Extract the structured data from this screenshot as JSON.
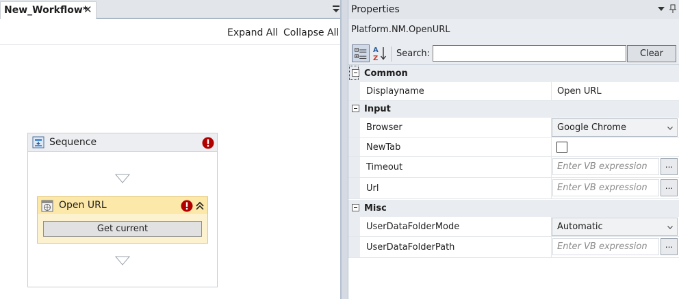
{
  "designer": {
    "tab_title": "New_Workflow*",
    "tab_close_icon": "close-icon",
    "expand_all": "Expand All",
    "collapse_all": "Collapse All",
    "sequence": {
      "title": "Sequence",
      "icon": "sequence-icon",
      "has_error": true,
      "activity": {
        "title": "Open URL",
        "icon": "browser-icon",
        "has_error": true,
        "button_label": "Get current"
      }
    }
  },
  "properties": {
    "title": "Properties",
    "class_name": "Platform.NM.OpenURL",
    "search_label": "Search:",
    "search_value": "",
    "clear_label": "Clear",
    "categories": [
      {
        "label": "Common",
        "rows": [
          {
            "name": "Displayname",
            "value": "Open URL"
          }
        ]
      },
      {
        "label": "Input",
        "rows": [
          {
            "name": "Browser",
            "value": "Google Chrome"
          },
          {
            "name": "NewTab",
            "value": ""
          },
          {
            "name": "Timeout",
            "placeholder": "Enter VB expression",
            "button": "..."
          },
          {
            "name": "Url",
            "placeholder": "Enter VB expression",
            "button": "..."
          }
        ]
      },
      {
        "label": "Misc",
        "rows": [
          {
            "name": "UserDataFolderMode",
            "value": "Automatic"
          },
          {
            "name": "UserDataFolderPath",
            "placeholder": "Enter VB expression",
            "button": "..."
          }
        ]
      }
    ]
  },
  "colors": {
    "activity_header": "#fce8a8",
    "activity_body": "#fdf2d0",
    "error_red": "#b00000",
    "panel_chrome": "#e2e5ea"
  }
}
